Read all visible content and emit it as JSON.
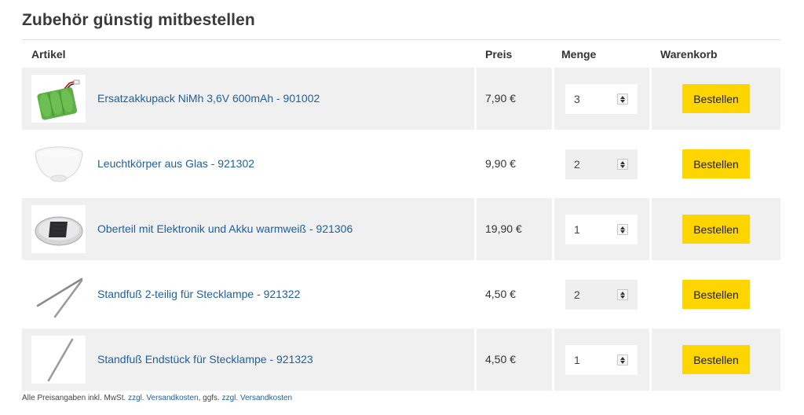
{
  "section": {
    "title": "Zubehör günstig mitbestellen"
  },
  "table": {
    "headers": {
      "artikel": "Artikel",
      "preis": "Preis",
      "menge": "Menge",
      "warenkorb": "Warenkorb"
    },
    "rows": [
      {
        "name": "Ersatzakkupack NiMh 3,6V 600mAh - 901002",
        "price": "7,90 €",
        "qty": "3",
        "button": "Bestellen",
        "image_icon": "battery-pack-image"
      },
      {
        "name": "Leuchtkörper aus Glas - 921302",
        "price": "9,90 €",
        "qty": "2",
        "button": "Bestellen",
        "image_icon": "glass-shade-image"
      },
      {
        "name": "Oberteil mit Elektronik und Akku warmweiß - 921306",
        "price": "19,90 €",
        "qty": "1",
        "button": "Bestellen",
        "image_icon": "solar-top-image"
      },
      {
        "name": "Standfuß 2-teilig für Stecklampe - 921322",
        "price": "4,50 €",
        "qty": "2",
        "button": "Bestellen",
        "image_icon": "stake-two-part-image"
      },
      {
        "name": "Standfuß Endstück für Stecklampe - 921323",
        "price": "4,50 €",
        "qty": "1",
        "button": "Bestellen",
        "image_icon": "stake-end-image"
      }
    ]
  },
  "footnote": {
    "prefix": "Alle Preisangaben inkl. MwSt.",
    "link1": "zzgl. Versandkosten",
    "sep": ", ggfs.",
    "link2": "zzgl. Versandkosten"
  },
  "colors": {
    "button": "#ffd500",
    "link": "#1f5fa0",
    "row_shade": "#f0f0f0"
  }
}
